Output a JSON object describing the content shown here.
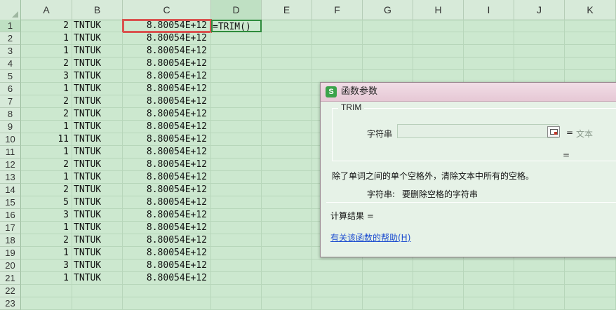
{
  "columns": [
    "A",
    "B",
    "C",
    "D",
    "E",
    "F",
    "G",
    "H",
    "I",
    "J",
    "K"
  ],
  "active_cell": {
    "column": "D",
    "row": "1"
  },
  "formula_cell_text": "=TRIM()",
  "rows": [
    {
      "n": "1",
      "a": "2",
      "b": "TNTUK",
      "c": "8.80054E+12"
    },
    {
      "n": "2",
      "a": "1",
      "b": "TNTUK",
      "c": "8.80054E+12"
    },
    {
      "n": "3",
      "a": "1",
      "b": "TNTUK",
      "c": "8.80054E+12"
    },
    {
      "n": "4",
      "a": "2",
      "b": "TNTUK",
      "c": "8.80054E+12"
    },
    {
      "n": "5",
      "a": "3",
      "b": "TNTUK",
      "c": "8.80054E+12"
    },
    {
      "n": "6",
      "a": "1",
      "b": "TNTUK",
      "c": "8.80054E+12"
    },
    {
      "n": "7",
      "a": "2",
      "b": "TNTUK",
      "c": "8.80054E+12"
    },
    {
      "n": "8",
      "a": "2",
      "b": "TNTUK",
      "c": "8.80054E+12"
    },
    {
      "n": "9",
      "a": "1",
      "b": "TNTUK",
      "c": "8.80054E+12"
    },
    {
      "n": "10",
      "a": "11",
      "b": "TNTUK",
      "c": "8.80054E+12"
    },
    {
      "n": "11",
      "a": "1",
      "b": "TNTUK",
      "c": "8.80054E+12"
    },
    {
      "n": "12",
      "a": "2",
      "b": "TNTUK",
      "c": "8.80054E+12"
    },
    {
      "n": "13",
      "a": "1",
      "b": "TNTUK",
      "c": "8.80054E+12"
    },
    {
      "n": "14",
      "a": "2",
      "b": "TNTUK",
      "c": "8.80054E+12"
    },
    {
      "n": "15",
      "a": "5",
      "b": "TNTUK",
      "c": "8.80054E+12"
    },
    {
      "n": "16",
      "a": "3",
      "b": "TNTUK",
      "c": "8.80054E+12"
    },
    {
      "n": "17",
      "a": "1",
      "b": "TNTUK",
      "c": "8.80054E+12"
    },
    {
      "n": "18",
      "a": "2",
      "b": "TNTUK",
      "c": "8.80054E+12"
    },
    {
      "n": "19",
      "a": "1",
      "b": "TNTUK",
      "c": "8.80054E+12"
    },
    {
      "n": "20",
      "a": "3",
      "b": "TNTUK",
      "c": "8.80054E+12"
    },
    {
      "n": "21",
      "a": "1",
      "b": "TNTUK",
      "c": "8.80054E+12"
    },
    {
      "n": "22",
      "a": "",
      "b": "",
      "c": ""
    },
    {
      "n": "23",
      "a": "",
      "b": "",
      "c": ""
    }
  ],
  "dialog": {
    "title": "函数参数",
    "icon": "wps-spreadsheet-icon",
    "function_name": "TRIM",
    "arg_label": "字符串",
    "arg_value": "",
    "equals": "=",
    "arg_hint": "文本",
    "description": "除了单词之间的单个空格外，清除文本中所有的空格。",
    "arg_desc_label": "字符串:",
    "arg_desc_text": "要删除空格的字符串",
    "result_label": "计算结果 =",
    "help_link": "有关该函数的帮助(H)"
  },
  "colors": {
    "sheet_bg": "#cce8cf",
    "highlight_border": "#d9534f",
    "active_border": "#2e8b3c",
    "link": "#1f4fd0"
  }
}
